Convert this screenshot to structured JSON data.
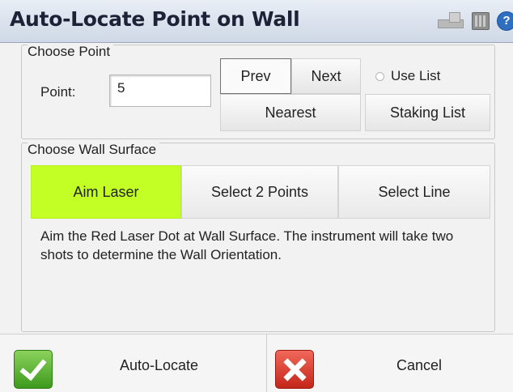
{
  "window": {
    "title": "Auto-Locate Point on Wall"
  },
  "titlebar_icons": [
    "document-icon",
    "keyboard-icon",
    "help-icon"
  ],
  "help_glyph": "?",
  "choose_point": {
    "legend": "Choose Point",
    "point_label": "Point:",
    "point_value": "5",
    "prev_label": "Prev",
    "next_label": "Next",
    "nearest_label": "Nearest",
    "use_list_label": "Use List",
    "use_list_checked": false,
    "staking_list_label": "Staking List"
  },
  "choose_wall": {
    "legend": "Choose Wall Surface",
    "tabs": [
      {
        "label": "Aim Laser",
        "selected": true
      },
      {
        "label": "Select 2 Points",
        "selected": false
      },
      {
        "label": "Select Line",
        "selected": false
      }
    ],
    "description": "Aim the Red Laser Dot at Wall Surface.  The instrument will take two shots to determine the Wall Orientation."
  },
  "footer": {
    "auto_locate_label": "Auto-Locate",
    "cancel_label": "Cancel"
  },
  "colors": {
    "selected_tab": "#c3ff25",
    "ok_green": "#3c9a1c",
    "cancel_red": "#c4261a"
  }
}
